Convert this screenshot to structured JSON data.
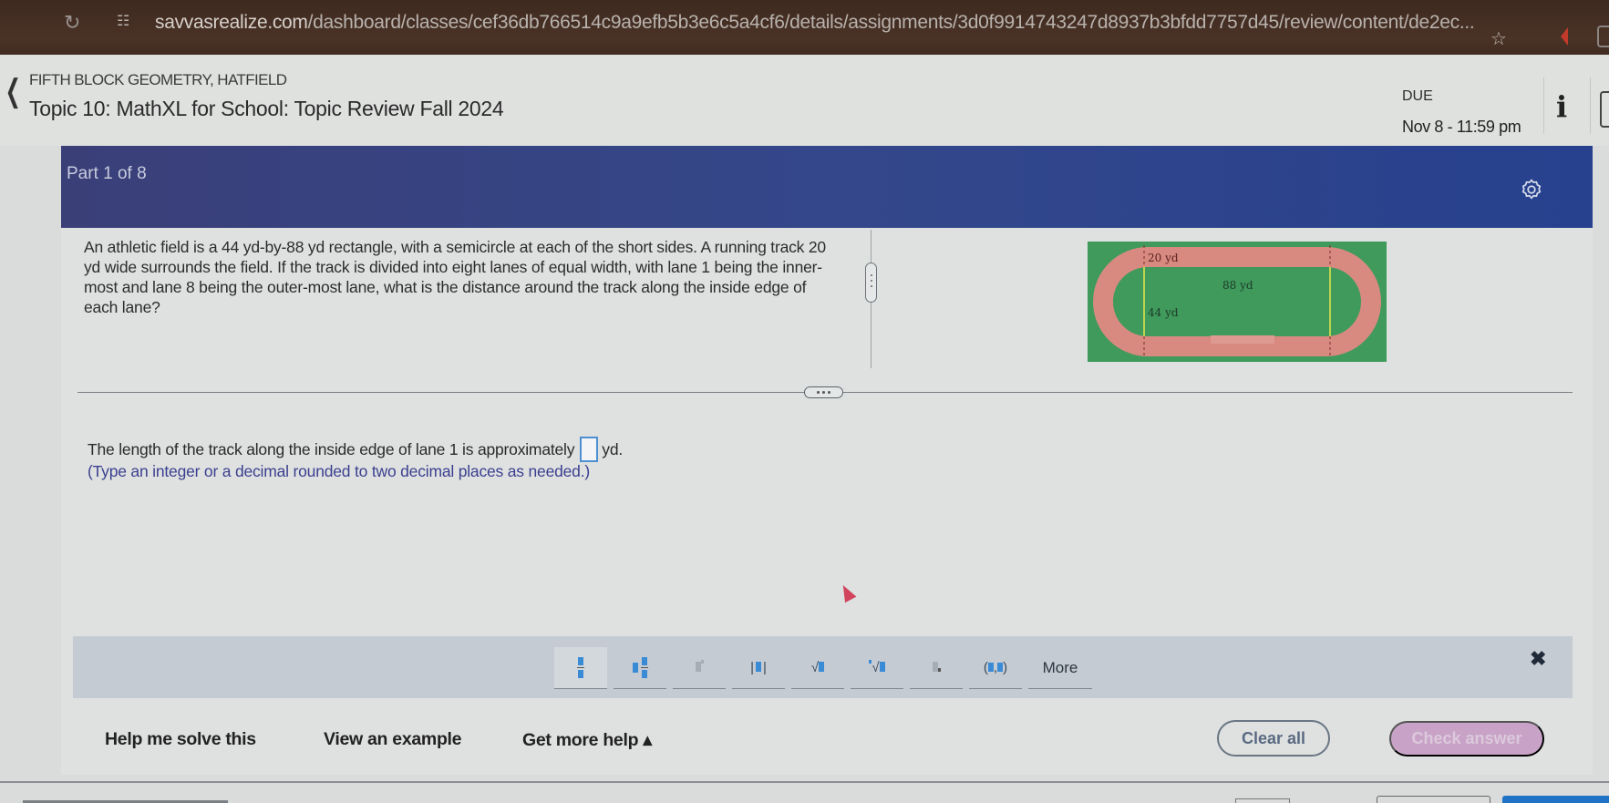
{
  "browser": {
    "reload_icon": "reload-icon",
    "site_info_icon": "tune-icon",
    "url_host": "savvasrealize.com",
    "url_path": "/dashboard/classes/cef36db766514c9a9efb5b3e6c5a4cf6/details/assignments/3d0f9914743247d8937b3bfdd7757d45/review/content/de2ec...",
    "bookmark_icon": "star-icon"
  },
  "header": {
    "back_icon": "chevron-left-icon",
    "course": "FIFTH BLOCK GEOMETRY, HATFIELD",
    "title": "Topic 10: MathXL for School: Topic Review Fall 2024",
    "due_label": "DUE",
    "due_date": "Nov 8 - 11:59 pm",
    "info_icon": "info-icon"
  },
  "banner": {
    "part": "Part 1 of 8",
    "settings_icon": "gear-icon"
  },
  "question": {
    "text": "An athletic field is a 44 yd-by-88 yd  rectangle, with a semicircle at each of the short sides. A running track 20 yd wide surrounds the field. If the track is divided into eight lanes of equal width, with lane 1 being the inner-most and lane 8 being the outer-most lane, what is the distance around the track along the inside edge of each lane?",
    "figure": {
      "label_track_width": "20 yd",
      "label_length": "88 yd",
      "label_width": "44 yd",
      "colors": {
        "field": "#3f9a5c",
        "track": "#d88a80",
        "marker": "#e4e84a"
      }
    }
  },
  "answer": {
    "prefix": "The length of the track along the inside edge of lane 1 is approximately",
    "value": "",
    "unit": "yd.",
    "hint": "(Type an integer or a decimal rounded to two decimal places as needed.)"
  },
  "math_toolbar": {
    "buttons": [
      {
        "name": "fraction",
        "icon": "fraction-icon"
      },
      {
        "name": "mixed-number",
        "icon": "mixed-number-icon"
      },
      {
        "name": "exponent",
        "icon": "exponent-icon"
      },
      {
        "name": "absolute-value",
        "icon": "absolute-value-icon"
      },
      {
        "name": "square-root",
        "icon": "square-root-icon"
      },
      {
        "name": "nth-root",
        "icon": "nth-root-icon"
      },
      {
        "name": "subscript",
        "icon": "subscript-icon"
      },
      {
        "name": "ordered-pair",
        "icon": "ordered-pair-icon",
        "label": "(▮,▮)"
      }
    ],
    "more_label": "More",
    "close_icon": "close-icon"
  },
  "actions": {
    "help_me_solve": "Help me solve this",
    "view_example": "View an example",
    "get_more_help": "Get more help ▴",
    "clear_all": "Clear all",
    "check_answer": "Check answer"
  }
}
